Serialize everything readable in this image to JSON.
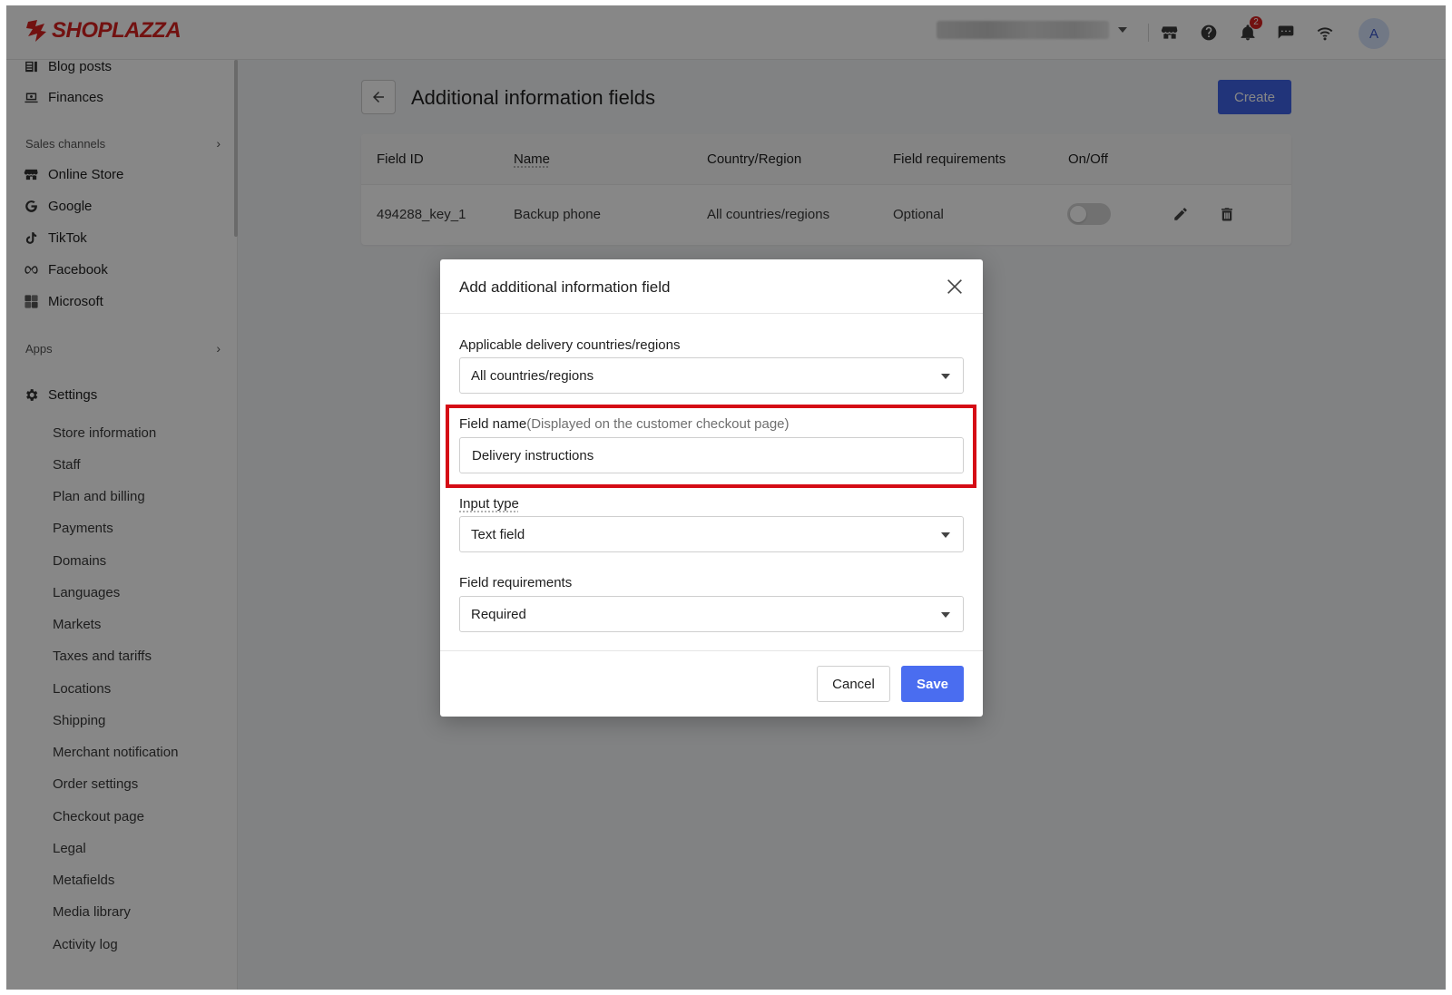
{
  "brand": {
    "name": "SHOPLAZZA",
    "color": "#d8201f"
  },
  "topbar": {
    "notification_count": "2",
    "avatar_initial": "A",
    "icons": [
      "store-icon",
      "help-icon",
      "bell-icon",
      "chat-icon",
      "wifi-icon"
    ]
  },
  "sidebar": {
    "top_items": [
      {
        "label": "Blog posts",
        "icon": "blog-icon"
      },
      {
        "label": "Finances",
        "icon": "finances-icon"
      }
    ],
    "sales_channels_label": "Sales channels",
    "channels": [
      {
        "label": "Online Store",
        "icon": "store-icon"
      },
      {
        "label": "Google",
        "icon": "google-icon"
      },
      {
        "label": "TikTok",
        "icon": "tiktok-icon"
      },
      {
        "label": "Facebook",
        "icon": "meta-icon"
      },
      {
        "label": "Microsoft",
        "icon": "microsoft-icon"
      }
    ],
    "apps_label": "Apps",
    "settings_label": "Settings",
    "settings_items": [
      "Store information",
      "Staff",
      "Plan and billing",
      "Payments",
      "Domains",
      "Languages",
      "Markets",
      "Taxes and tariffs",
      "Locations",
      "Shipping",
      "Merchant notification",
      "Order settings",
      "Checkout page",
      "Legal",
      "Metafields",
      "Media library",
      "Activity log"
    ]
  },
  "page": {
    "title": "Additional information fields",
    "create_label": "Create",
    "accent": "#3f63e6"
  },
  "table": {
    "headers": [
      "Field ID",
      "Name",
      "Country/Region",
      "Field requirements",
      "On/Off"
    ],
    "rows": [
      {
        "field_id": "494288_key_1",
        "name": "Backup phone",
        "country": "All countries/regions",
        "requirement": "Optional",
        "enabled": false
      }
    ]
  },
  "modal": {
    "title": "Add additional information field",
    "countries_label": "Applicable delivery countries/regions",
    "countries_value": "All countries/regions",
    "field_name_label": "Field name",
    "field_name_hint": "(Displayed on the customer checkout page)",
    "field_name_value": "Delivery instructions",
    "input_type_label": "Input type",
    "input_type_value": "Text field",
    "requirements_label": "Field requirements",
    "requirements_value": "Required",
    "cancel_label": "Cancel",
    "save_label": "Save",
    "highlight_color": "#d50c15"
  }
}
